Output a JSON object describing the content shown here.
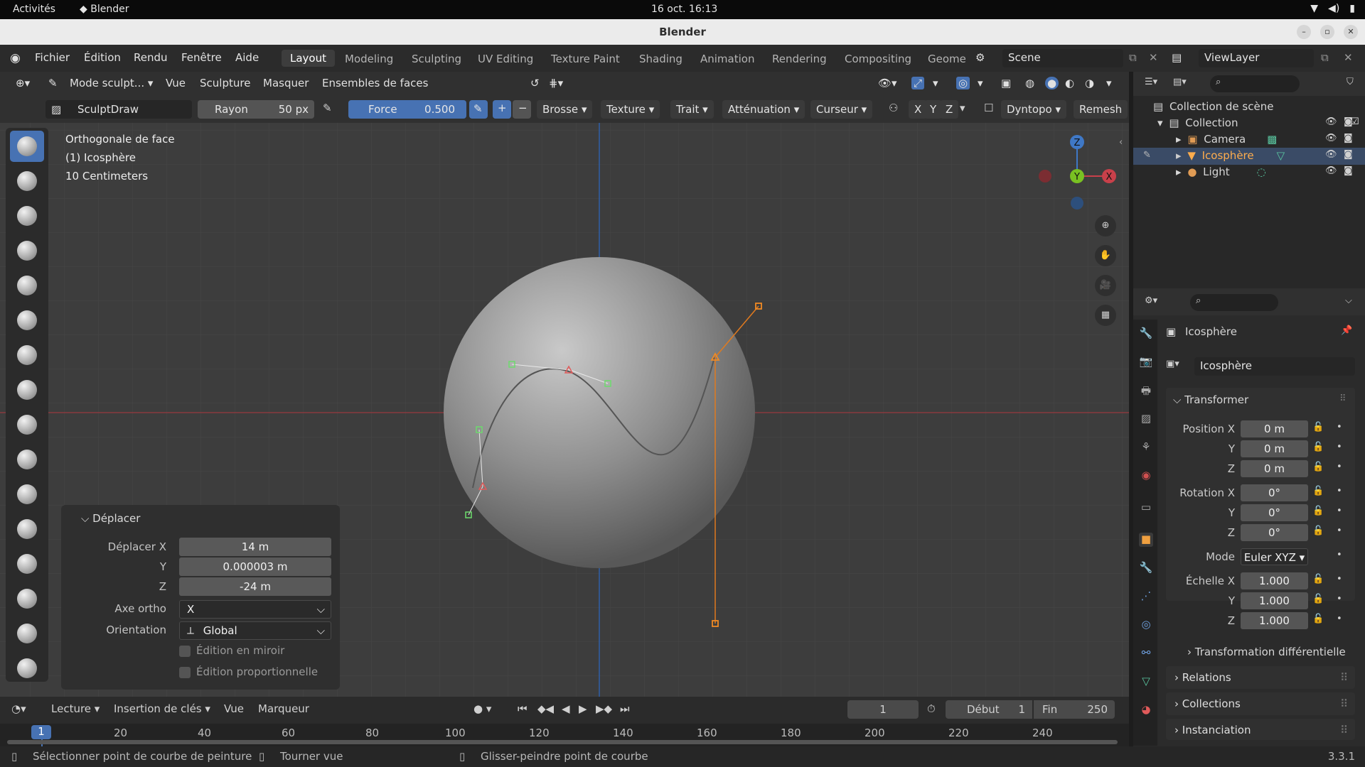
{
  "system": {
    "activities": "Activités",
    "app_name": "Blender",
    "clock": "16 oct.  16:13"
  },
  "window": {
    "title": "Blender"
  },
  "menu": [
    "Fichier",
    "Édition",
    "Rendu",
    "Fenêtre",
    "Aide"
  ],
  "workspaces": [
    "Layout",
    "Modeling",
    "Sculpting",
    "UV Editing",
    "Texture Paint",
    "Shading",
    "Animation",
    "Rendering",
    "Compositing",
    "Geome"
  ],
  "active_workspace": "Layout",
  "scene": "Scene",
  "view_layer": "ViewLayer",
  "viewport_header": {
    "mode": "Mode sculpt...",
    "items": [
      "Vue",
      "Sculpture",
      "Masquer",
      "Ensembles de faces"
    ]
  },
  "tool_header": {
    "brush": "SculptDraw",
    "radius_label": "Rayon",
    "radius_value": "50 px",
    "strength_label": "Force",
    "strength_value": "0.500",
    "dropdowns": [
      "Brosse",
      "Texture",
      "Trait",
      "Atténuation",
      "Curseur"
    ],
    "axes": [
      "X",
      "Y",
      "Z"
    ],
    "dyntopo": "Dyntopo",
    "remesh": "Remesh"
  },
  "viewport_info": {
    "view": "Orthogonale de face",
    "object": "(1) Icosphère",
    "scale": "10 Centimeters"
  },
  "gizmo": {
    "z": "Z",
    "y": "Y",
    "x": "X"
  },
  "last_operator": {
    "title": "Déplacer",
    "move_x_label": "Déplacer X",
    "move_x": "14 m",
    "move_y_label": "Y",
    "move_y": "0.000003 m",
    "move_z_label": "Z",
    "move_z": "-24 m",
    "ortho_label": "Axe ortho",
    "ortho": "X",
    "orient_label": "Orientation",
    "orient": "Global",
    "mirror": "Édition en miroir",
    "proportional": "Édition proportionnelle"
  },
  "outliner": {
    "root": "Collection de scène",
    "collection": "Collection",
    "items": [
      "Camera",
      "Icosphère",
      "Light"
    ],
    "selected": "Icosphère"
  },
  "properties": {
    "object_name": "Icosphère",
    "data_name": "Icosphère",
    "transform_title": "Transformer",
    "location_label": "Position X",
    "loc": [
      "0 m",
      "0 m",
      "0 m"
    ],
    "rotation_label": "Rotation X",
    "rot": [
      "0°",
      "0°",
      "0°"
    ],
    "mode_label": "Mode",
    "mode": "Euler XYZ",
    "scale_label": "Échelle X",
    "scale": [
      "1.000",
      "1.000",
      "1.000"
    ],
    "axis_y": "Y",
    "axis_z": "Z",
    "delta": "Transformation différentielle",
    "sections": [
      "Relations",
      "Collections",
      "Instanciation"
    ]
  },
  "timeline": {
    "menus": [
      "Lecture",
      "Insertion de clés",
      "Vue",
      "Marqueur"
    ],
    "current_frame": "1",
    "start_label": "Début",
    "start": "1",
    "end_label": "Fin",
    "end": "250",
    "ticks": [
      "20",
      "40",
      "60",
      "80",
      "100",
      "120",
      "140",
      "160",
      "180",
      "200",
      "220",
      "240"
    ],
    "playhead": "1"
  },
  "status": {
    "left": "Sélectionner point de courbe de peinture",
    "middle": "Tourner vue",
    "right": "Glisser-peindre point de courbe",
    "version": "3.3.1"
  }
}
